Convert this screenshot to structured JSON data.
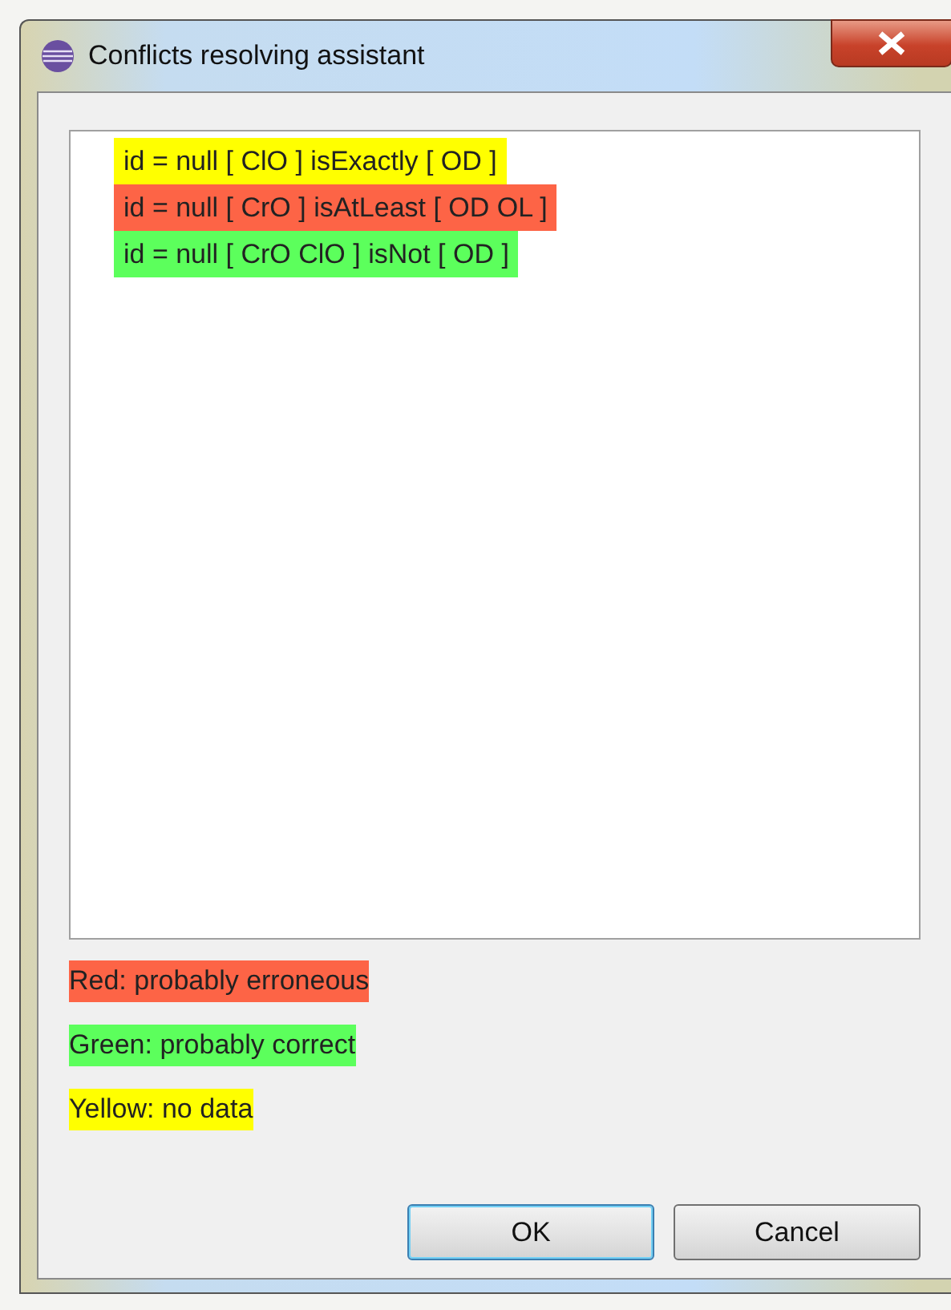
{
  "window": {
    "title": "Conflicts resolving assistant"
  },
  "conflicts": [
    {
      "text": "id = null [ ClO ] isExactly [ OD ]",
      "color": "#ffff00"
    },
    {
      "text": "id = null [ CrO ] isAtLeast [ OD OL ]",
      "color": "#fd6446"
    },
    {
      "text": "id = null [ CrO ClO ] isNot [ OD ]",
      "color": "#5cff5c"
    }
  ],
  "legend": [
    {
      "text": "Red: probably erroneous",
      "color": "#fd6446"
    },
    {
      "text": "Green: probably correct",
      "color": "#5cff5c"
    },
    {
      "text": "Yellow: no data",
      "color": "#ffff00"
    }
  ],
  "buttons": [
    {
      "label": "OK",
      "default": true
    },
    {
      "label": "Cancel",
      "default": false
    }
  ]
}
